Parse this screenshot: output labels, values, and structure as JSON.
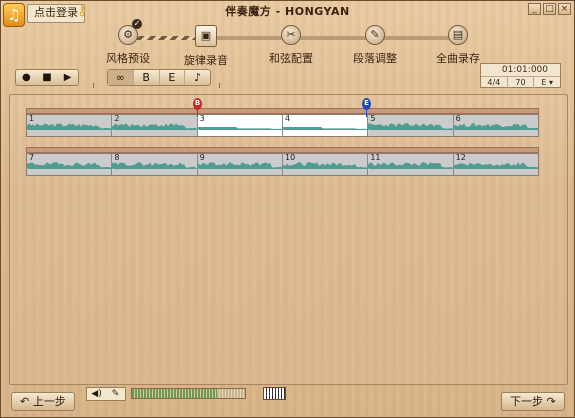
{
  "app": {
    "title": "伴奏魔方 - HONGYAN",
    "login_label": "点击登录",
    "music_icon": "♫",
    "key_icon": "key-icon",
    "window_buttons": [
      "_",
      "□",
      "×"
    ]
  },
  "steps": [
    {
      "label": "风格预设",
      "icon": "⚙",
      "completed": true
    },
    {
      "label": "旋律录音",
      "icon": "▣",
      "active": true
    },
    {
      "label": "和弦配置",
      "icon": "✂"
    },
    {
      "label": "段落调整",
      "icon": "✎"
    },
    {
      "label": "全曲录存",
      "icon": "▤"
    }
  ],
  "transport": {
    "record": "●",
    "stop": "■",
    "play": "▶"
  },
  "tools": [
    {
      "name": "link",
      "glyph": "∞",
      "active": true
    },
    {
      "name": "marker-b",
      "glyph": "B"
    },
    {
      "name": "marker-e",
      "glyph": "E"
    },
    {
      "name": "notes",
      "glyph": "♪"
    }
  ],
  "info": {
    "time": "01:01:000",
    "meter": "4/4",
    "tempo": "70",
    "key": "E",
    "key_dropdown": "▾"
  },
  "markers": {
    "start": "B",
    "end": "E"
  },
  "tracks": [
    {
      "bars": [
        {
          "num": "1",
          "seed": 3
        },
        {
          "num": "2",
          "seed": 7
        },
        {
          "num": "3",
          "seed": 0,
          "selected": true
        },
        {
          "num": "4",
          "seed": 0,
          "selected": true
        },
        {
          "num": "5",
          "seed": 11
        },
        {
          "num": "6",
          "seed": 5
        }
      ]
    },
    {
      "bars": [
        {
          "num": "7",
          "seed": 2
        },
        {
          "num": "8",
          "seed": 9
        },
        {
          "num": "9",
          "seed": 13
        },
        {
          "num": "10",
          "seed": 6
        },
        {
          "num": "11",
          "seed": 4
        },
        {
          "num": "12",
          "seed": 8
        }
      ]
    }
  ],
  "bottom": {
    "prev_label": "上一步",
    "next_label": "下一步",
    "prev_icon": "↶",
    "next_icon": "↷",
    "speaker_icon": "🔊",
    "mic_icon": "🎤",
    "level": 0.75
  },
  "colors": {
    "wave": "#4e9c92",
    "selected_bg": "#ffffff"
  }
}
